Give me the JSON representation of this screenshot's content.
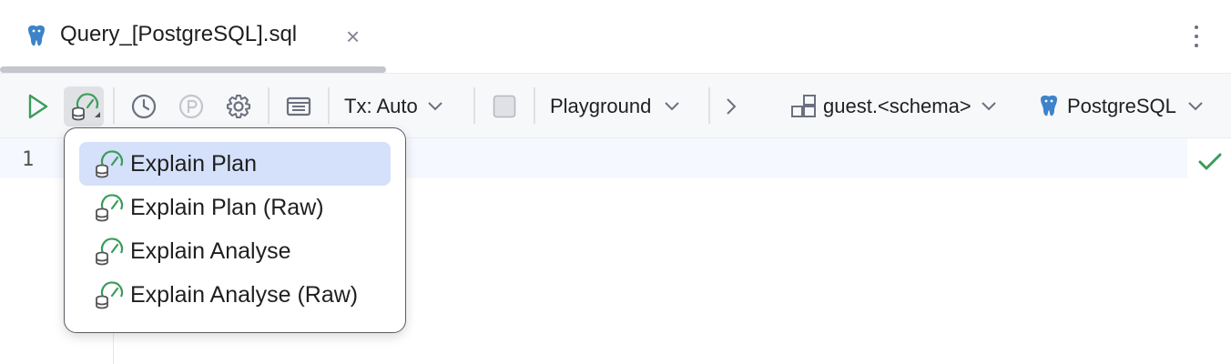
{
  "tab": {
    "title": "Query_[PostgreSQL].sql",
    "close_glyph": "×"
  },
  "toolbar": {
    "tx_label": "Tx: Auto",
    "playground_label": "Playground",
    "schema_label": "guest.<schema>",
    "datasource_label": "PostgreSQL"
  },
  "editor": {
    "line_numbers": [
      "1"
    ]
  },
  "explain_menu": {
    "items": [
      {
        "label": "Explain Plan",
        "selected": true
      },
      {
        "label": "Explain Plan (Raw)",
        "selected": false
      },
      {
        "label": "Explain Analyse",
        "selected": false
      },
      {
        "label": "Explain Analyse (Raw)",
        "selected": false
      }
    ]
  },
  "colors": {
    "accent": "#3574f0",
    "run_green": "#3b9c5a",
    "selection": "#d5e0fa",
    "pg_blue": "#3c83c9"
  },
  "icons": [
    "postgresql-icon",
    "close-icon",
    "more-vertical-icon",
    "run-icon",
    "explain-plan-icon",
    "history-icon",
    "pin-icon",
    "settings-icon",
    "layout-icon",
    "chevron-down-icon",
    "stop-icon",
    "chevron-right-icon",
    "schema-icon",
    "checkmark-icon"
  ]
}
